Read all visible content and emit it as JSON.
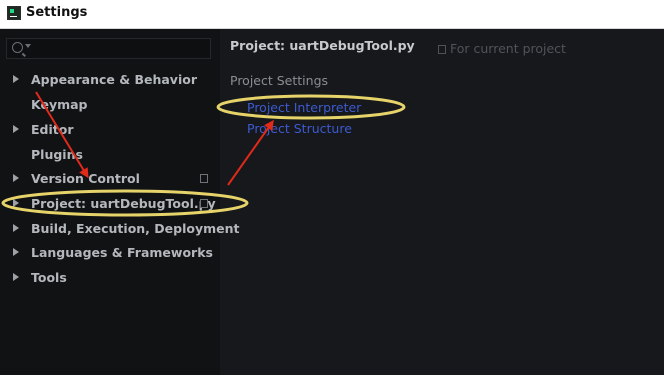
{
  "window": {
    "title": "Settings"
  },
  "sidebar": {
    "search": {
      "placeholder": ""
    },
    "items": [
      {
        "label": "Appearance & Behavior",
        "expandable": true,
        "copy_icon": false
      },
      {
        "label": "Keymap",
        "expandable": false,
        "copy_icon": false
      },
      {
        "label": "Editor",
        "expandable": true,
        "copy_icon": false
      },
      {
        "label": "Plugins",
        "expandable": false,
        "copy_icon": false
      },
      {
        "label": "Version Control",
        "expandable": true,
        "copy_icon": true
      },
      {
        "label": "Project: uartDebugTool.py",
        "expandable": true,
        "copy_icon": true
      },
      {
        "label": "Build, Execution, Deployment",
        "expandable": true,
        "copy_icon": false
      },
      {
        "label": "Languages & Frameworks",
        "expandable": true,
        "copy_icon": false
      },
      {
        "label": "Tools",
        "expandable": true,
        "copy_icon": false
      }
    ]
  },
  "main": {
    "title": "Project: uartDebugTool.py",
    "scope_label": "For current project",
    "section_heading": "Project Settings",
    "links": [
      {
        "label": "Project Interpreter"
      },
      {
        "label": "Project Structure"
      }
    ]
  },
  "colors": {
    "sidebar_bg": "#101214",
    "main_bg": "#16181c",
    "link": "#3d5ad0",
    "highlight_ellipse": "#e6d36a",
    "arrow": "#e02a1a"
  }
}
